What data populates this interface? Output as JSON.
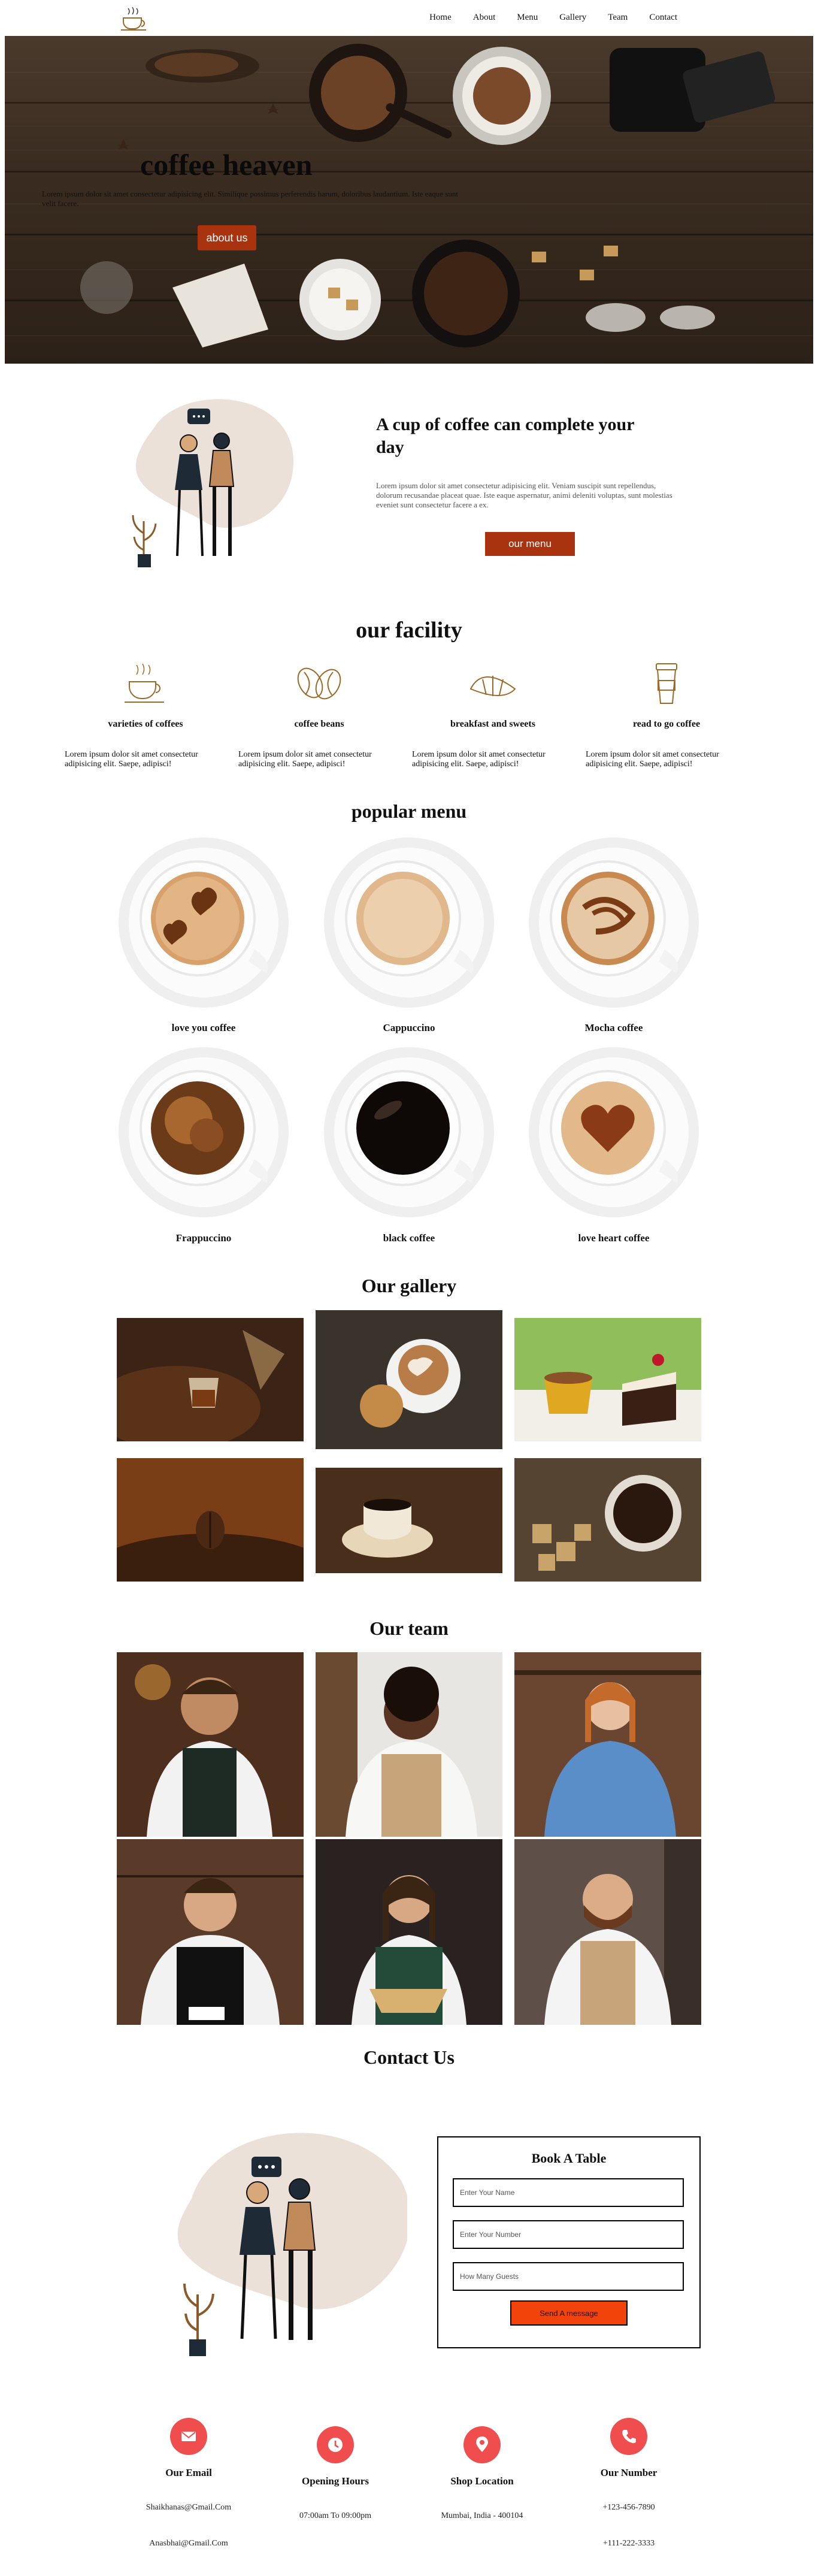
{
  "nav": {
    "logo_icon": "coffee-cup-icon",
    "links": [
      "Home",
      "About",
      "Menu",
      "Gallery",
      "Team",
      "Contact"
    ]
  },
  "hero": {
    "title": "coffee heaven",
    "text": "Lorem ipsum dolor sit amet consectetur adipisicing elit. Similique possimus perferendis harum, doloribus laudantium. Iste eaque sunt velit facere.",
    "button": "about us"
  },
  "about": {
    "title": "A cup of coffee can complete your day",
    "text": "Lorem ipsum dolor sit amet consectetur adipisicing elit. Veniam suscipit sunt repellendus, dolorum recusandae placeat quae. Iste eaque aspernatur, animi deleniti voluptas, sunt molestias eveniet sunt consectetur facere a ex.",
    "button": "our menu"
  },
  "facility": {
    "title": "our facility",
    "items": [
      {
        "icon": "coffee-cup-icon",
        "name": "varieties of coffees",
        "desc": "Lorem ipsum dolor sit amet consectetur adipisicing elit. Saepe, adipisci!"
      },
      {
        "icon": "coffee-beans-icon",
        "name": "coffee beans",
        "desc": "Lorem ipsum dolor sit amet consectetur adipisicing elit. Saepe, adipisci!"
      },
      {
        "icon": "croissant-icon",
        "name": "breakfast and sweets",
        "desc": "Lorem ipsum dolor sit amet consectetur adipisicing elit. Saepe, adipisci!"
      },
      {
        "icon": "takeaway-cup-icon",
        "name": "read to go coffee",
        "desc": "Lorem ipsum dolor sit amet consectetur adipisicing elit. Saepe, adipisci!"
      }
    ]
  },
  "menu": {
    "title": "popular menu",
    "items": [
      "love you coffee",
      "Cappuccino",
      "Mocha coffee",
      "Frappuccino",
      "black coffee",
      "love heart coffee"
    ]
  },
  "gallery": {
    "title": "Our gallery"
  },
  "team": {
    "title": "Our team"
  },
  "contact": {
    "title": "Contact Us",
    "form_title": "Book A Table",
    "placeholders": [
      "Enter Your Name",
      "Enter Your Number",
      "How Many Guests"
    ],
    "send": "Send A message"
  },
  "info": [
    {
      "icon": "email-icon",
      "title": "Our Email",
      "lines": [
        "Shaikhanas@Gmail.Com",
        "Anasbhai@Gmail.Com"
      ]
    },
    {
      "icon": "clock-icon",
      "title": "Opening Hours",
      "lines": [
        "07:00am To 09:00pm"
      ]
    },
    {
      "icon": "location-pin-icon",
      "title": "Shop Location",
      "lines": [
        "Mumbai, India - 400104"
      ]
    },
    {
      "icon": "phone-icon",
      "title": "Our Number",
      "lines": [
        "+123-456-7890",
        "+111-222-3333"
      ]
    }
  ],
  "colors": {
    "accent": "#a9320f",
    "send": "#f2430a",
    "info_circle": "#f04e4e",
    "blob": "#ebe1d8"
  }
}
